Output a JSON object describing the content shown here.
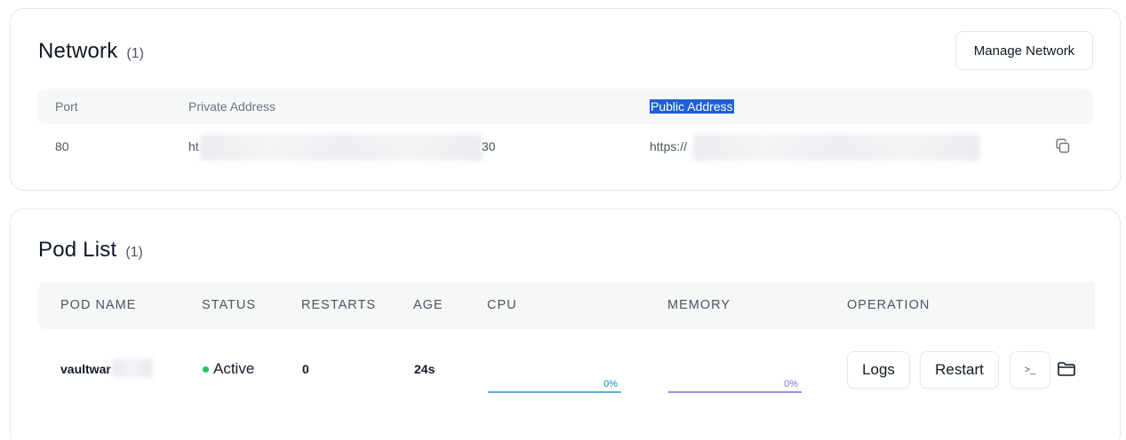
{
  "network": {
    "title": "Network",
    "count": "(1)",
    "manage_label": "Manage Network",
    "columns": [
      "Port",
      "Private Address",
      "Public Address"
    ],
    "rows": [
      {
        "port": "80",
        "private_prefix": "ht",
        "private_suffix": "30",
        "public_prefix": "https://"
      }
    ]
  },
  "pods": {
    "title": "Pod List",
    "count": "(1)",
    "columns": [
      "POD NAME",
      "STATUS",
      "RESTARTS",
      "AGE",
      "CPU",
      "MEMORY",
      "OPERATION"
    ],
    "rows": [
      {
        "name": "vaultwar",
        "status": "Active",
        "restarts": "0",
        "age": "24s",
        "cpu": "0%",
        "memory": "0%",
        "logs_label": "Logs",
        "restart_label": "Restart",
        "terminal_glyph": ">_"
      }
    ]
  },
  "colors": {
    "status_active": "#22c55e",
    "cpu_bar": "#5ab4e6",
    "memory_bar": "#9b8cf0",
    "selection": "#1d5fd6"
  },
  "icons": [
    "copy-icon",
    "terminal-icon",
    "folder-icon"
  ]
}
